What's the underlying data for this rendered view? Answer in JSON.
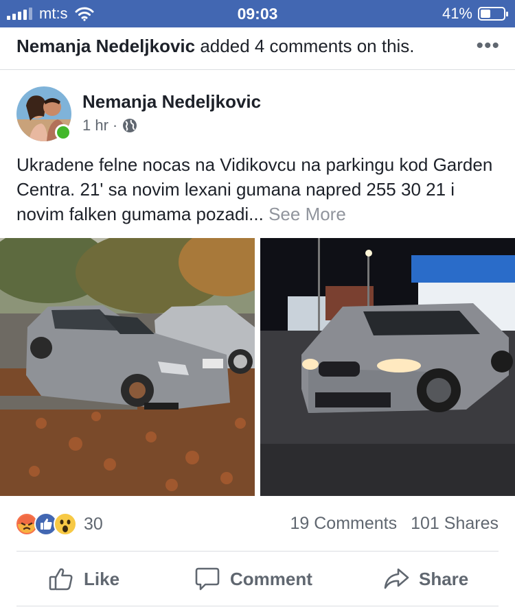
{
  "status_bar": {
    "carrier": "mt:s",
    "time": "09:03",
    "battery_percent": "41%",
    "battery_level": 0.41
  },
  "activity": {
    "actor": "Nemanja Nedeljkovic",
    "action_text": " added 4 comments on this.",
    "more_icon": "ellipsis-icon"
  },
  "post": {
    "author": "Nemanja Nedeljkovic",
    "time": "1 hr",
    "separator": "·",
    "privacy_icon": "globe-icon",
    "text": "Ukradene felne nocas na Vidikovcu na parkingu kod Garden Centra. 21' sa novim lexani gumana napred 255 30 21 i novim falken gumama pozadi... ",
    "see_more": "See More"
  },
  "engagement": {
    "reaction_icons": [
      "angry-icon",
      "like-icon",
      "wow-icon"
    ],
    "reaction_count": "30",
    "comments": "19 Comments",
    "shares": "101 Shares"
  },
  "actions": {
    "like": "Like",
    "comment": "Comment",
    "share": "Share"
  },
  "colors": {
    "brand_blue": "#4267b2",
    "text": "#1d2129",
    "secondary": "#606770",
    "online": "#42b72a"
  }
}
